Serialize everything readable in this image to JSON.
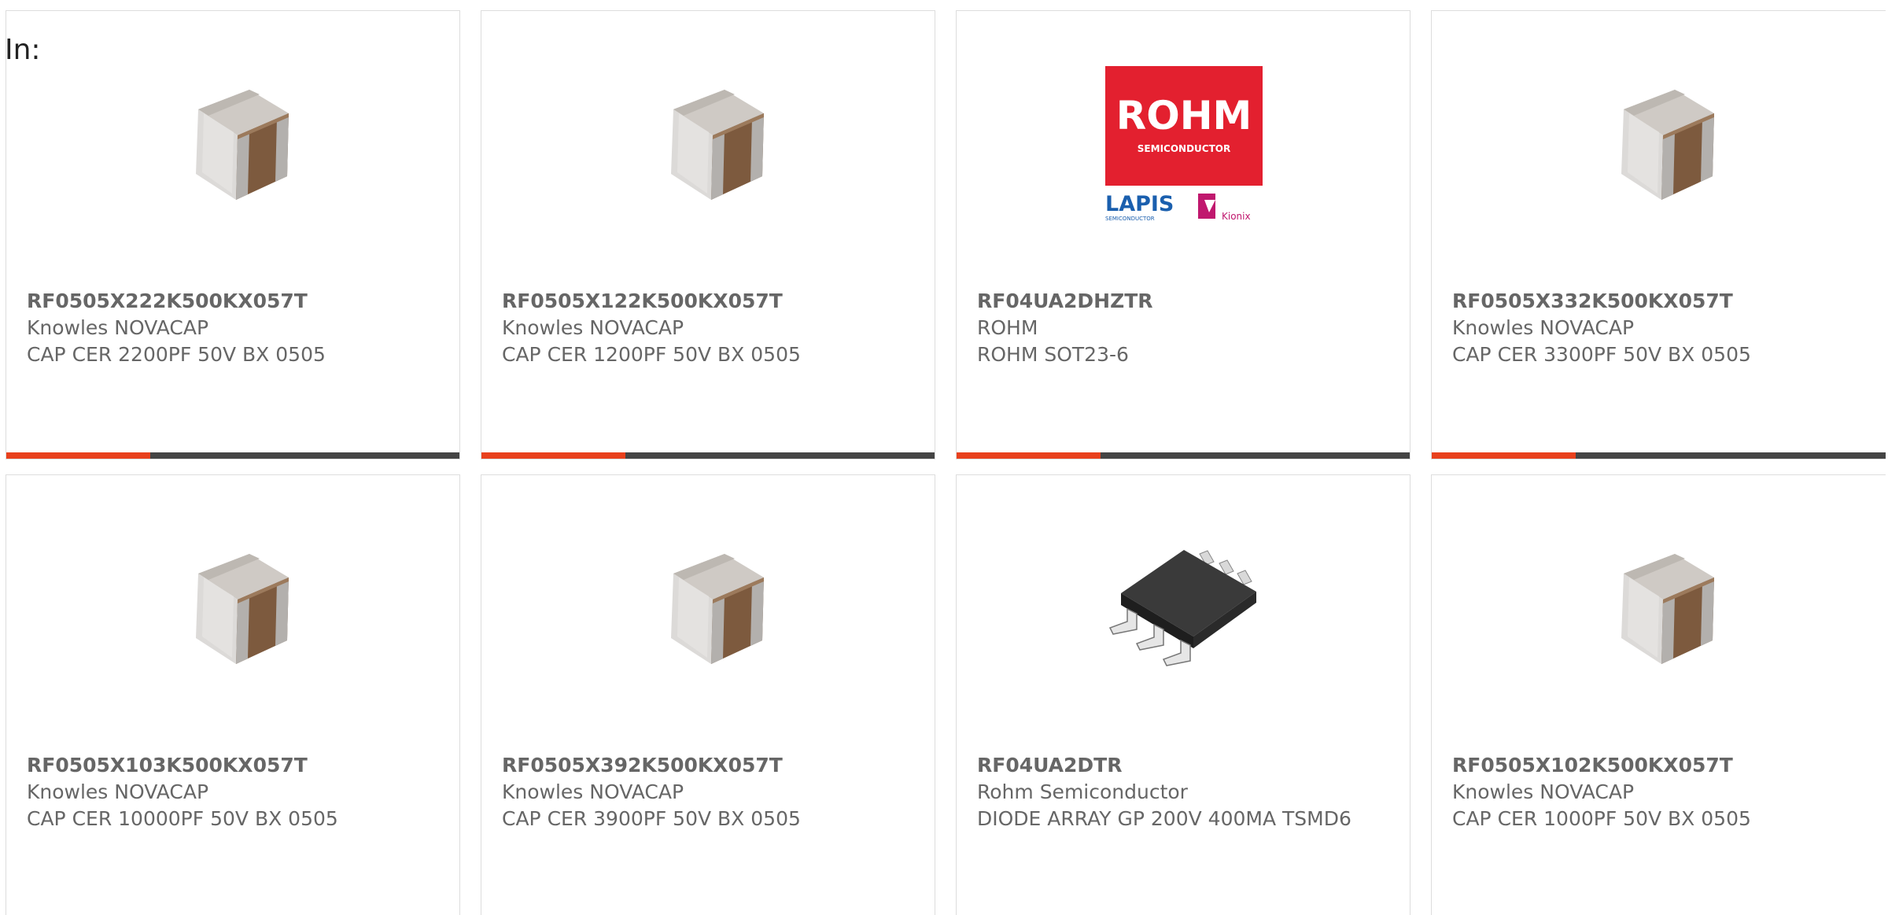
{
  "header": {
    "in_label": "In:"
  },
  "logo": {
    "rohm_text": "ROHM",
    "rohm_sub": "SEMICONDUCTOR",
    "lapis_text": "LAPIS",
    "lapis_sub": "SEMICONDUCTOR",
    "kionix_text": "Kionix"
  },
  "colors": {
    "accent": "#e8401c",
    "bar": "#444444",
    "rohm_red": "#e3202f",
    "lapis_blue": "#1a5fae"
  },
  "products": [
    {
      "part_number": "RF0505X222K500KX057T",
      "manufacturer": "Knowles NOVACAP",
      "description": "CAP CER 2200PF 50V BX 0505",
      "image": "ceramic-capacitor-icon"
    },
    {
      "part_number": "RF0505X122K500KX057T",
      "manufacturer": "Knowles NOVACAP",
      "description": "CAP CER 1200PF 50V BX 0505",
      "image": "ceramic-capacitor-icon"
    },
    {
      "part_number": "RF04UA2DHZTR",
      "manufacturer": "ROHM",
      "description": "ROHM SOT23-6",
      "image": "rohm-logo"
    },
    {
      "part_number": "RF0505X332K500KX057T",
      "manufacturer": "Knowles NOVACAP",
      "description": "CAP CER 3300PF 50V BX 0505",
      "image": "ceramic-capacitor-icon"
    },
    {
      "part_number": "RF0505X103K500KX057T",
      "manufacturer": "Knowles NOVACAP",
      "description": "CAP CER 10000PF 50V BX 0505",
      "image": "ceramic-capacitor-icon"
    },
    {
      "part_number": "RF0505X392K500KX057T",
      "manufacturer": "Knowles NOVACAP",
      "description": "CAP CER 3900PF 50V BX 0505",
      "image": "ceramic-capacitor-icon"
    },
    {
      "part_number": "RF04UA2DTR",
      "manufacturer": "Rohm Semiconductor",
      "description": "DIODE ARRAY GP 200V 400MA TSMD6",
      "image": "ic-package-icon"
    },
    {
      "part_number": "RF0505X102K500KX057T",
      "manufacturer": "Knowles NOVACAP",
      "description": "CAP CER 1000PF 50V BX 0505",
      "image": "ceramic-capacitor-icon"
    }
  ]
}
